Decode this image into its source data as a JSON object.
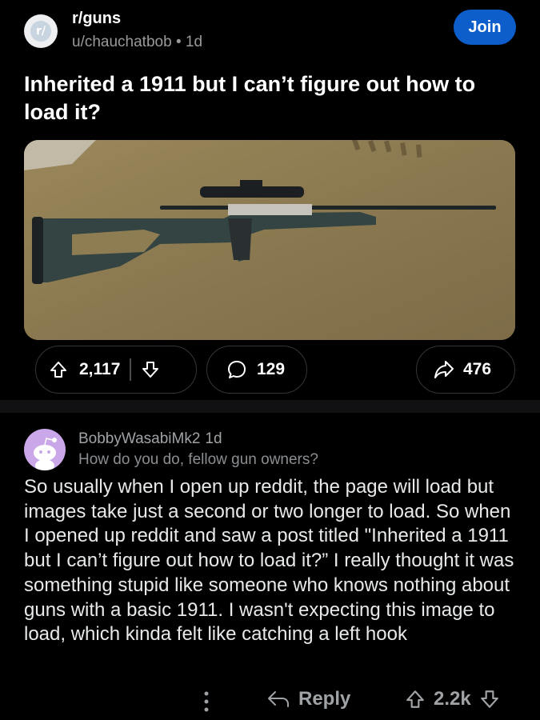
{
  "post": {
    "subreddit": "r/guns",
    "subreddit_icon_text": "r/",
    "author": "u/chauchatbob",
    "age": "1d",
    "join_label": "Join",
    "title": "Inherited a 1911 but I can’t figure out how to load it?",
    "votes": "2,117",
    "comments": "129",
    "shares": "476"
  },
  "comment": {
    "author": "BobbyWasabiMk2",
    "age": "1d",
    "flair": "How do you do, fellow gun owners?",
    "body": "So usually when I open up reddit, the page will load but images take just a second or two longer to load. So when I opened up reddit and saw a post titled \"Inherited a 1911 but I can’t figure out how to load it?” I really thought it was something stupid like someone who knows nothing about guns with a basic 1911. I wasn't expecting this image to load, which kinda felt like catching a left hook",
    "reply_label": "Reply",
    "votes": "2.2k"
  },
  "colors": {
    "background": "#000000",
    "accent": "#0d5ecb",
    "text": "#e7e9ea",
    "muted": "#9fa3a6"
  },
  "icons": [
    "subreddit-icon",
    "upvote-icon",
    "downvote-icon",
    "comment-icon",
    "share-icon",
    "snoo-avatar",
    "more-icon",
    "reply-icon"
  ]
}
